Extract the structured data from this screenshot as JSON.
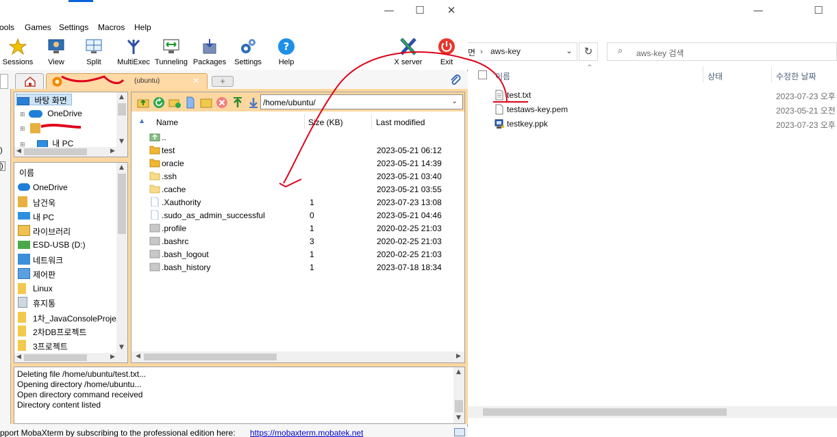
{
  "moba": {
    "window_controls": {
      "minimize": "—",
      "maximize": "☐",
      "close": "✕"
    },
    "menu": [
      "ools",
      "Games",
      "Settings",
      "Macros",
      "Help"
    ],
    "toolbar": [
      {
        "label": "Sessions",
        "icon": "star-icon"
      },
      {
        "label": "View",
        "icon": "monitor-icon"
      },
      {
        "label": "Split",
        "icon": "split-icon"
      },
      {
        "label": "MultiExec",
        "icon": "fork-icon"
      },
      {
        "label": "Tunneling",
        "icon": "tunnel-icon"
      },
      {
        "label": "Packages",
        "icon": "package-icon"
      },
      {
        "label": "Settings",
        "icon": "gear-icon"
      },
      {
        "label": "Help",
        "icon": "help-icon"
      },
      {
        "label": "X server",
        "icon": "x-server-icon"
      },
      {
        "label": "Exit",
        "icon": "power-icon"
      }
    ],
    "session_tab": {
      "label": "(ubuntu)",
      "close": "✕"
    },
    "tree": [
      "바탕 화면",
      "OneDrive",
      "",
      "내 PC"
    ],
    "locations": [
      "이름",
      "OneDrive",
      "남건욱",
      "내 PC",
      "라이브러리",
      "ESD-USB (D:)",
      "네트워크",
      "제어판",
      "Linux",
      "휴지통",
      "1차_JavaConsoleProje",
      "2차DB프로젝트",
      "3프로젝트"
    ],
    "path": "/home/ubuntu/",
    "columns": {
      "name": "Name",
      "size": "Size (KB)",
      "modified": "Last modified"
    },
    "files": [
      {
        "name": "..",
        "size": "",
        "modified": "",
        "type": "up"
      },
      {
        "name": "test",
        "size": "",
        "modified": "2023-05-21 06:12",
        "type": "folder"
      },
      {
        "name": "oracle",
        "size": "",
        "modified": "2023-05-21 14:39",
        "type": "folder"
      },
      {
        "name": ".ssh",
        "size": "",
        "modified": "2023-05-21 03:40",
        "type": "folder-light"
      },
      {
        "name": ".cache",
        "size": "",
        "modified": "2023-05-21 03:55",
        "type": "folder-light"
      },
      {
        "name": ".Xauthority",
        "size": "1",
        "modified": "2023-07-23 13:08",
        "type": "file"
      },
      {
        "name": ".sudo_as_admin_successful",
        "size": "0",
        "modified": "2023-05-21 04:46",
        "type": "file"
      },
      {
        "name": ".profile",
        "size": "1",
        "modified": "2020-02-25 21:03",
        "type": "grey"
      },
      {
        "name": ".bashrc",
        "size": "3",
        "modified": "2020-02-25 21:03",
        "type": "grey"
      },
      {
        "name": ".bash_logout",
        "size": "1",
        "modified": "2020-02-25 21:03",
        "type": "grey"
      },
      {
        "name": ".bash_history",
        "size": "1",
        "modified": "2023-07-18 18:34",
        "type": "grey"
      }
    ],
    "log": [
      "Deleting file /home/ubuntu/test.txt...",
      "Opening directory /home/ubuntu...",
      "Open directory command received",
      "Directory content listed"
    ],
    "status": {
      "text": "pport MobaXterm by subscribing to the professional edition here:",
      "link": "https://mobaxterm.mobatek.net"
    }
  },
  "explorer": {
    "window_controls": {
      "minimize": "—",
      "maximize": "☐"
    },
    "breadcrumb": [
      "면",
      "aws-key"
    ],
    "search_placeholder": "aws-key 검색",
    "columns": {
      "name": "이름",
      "status": "상태",
      "modified": "수정한 날짜"
    },
    "files": [
      {
        "name": "test.txt",
        "modified": "2023-07-23 오후",
        "icon": "text-file-icon"
      },
      {
        "name": "testaws-key.pem",
        "modified": "2023-05-21 오전",
        "icon": "blank-file-icon"
      },
      {
        "name": "testkey.ppk",
        "modified": "2023-07-23 오후",
        "icon": "putty-key-icon"
      }
    ]
  },
  "colors": {
    "sftp_frame": "#fcd7a0",
    "annotation": "#e0001a",
    "link": "#0000cc"
  }
}
